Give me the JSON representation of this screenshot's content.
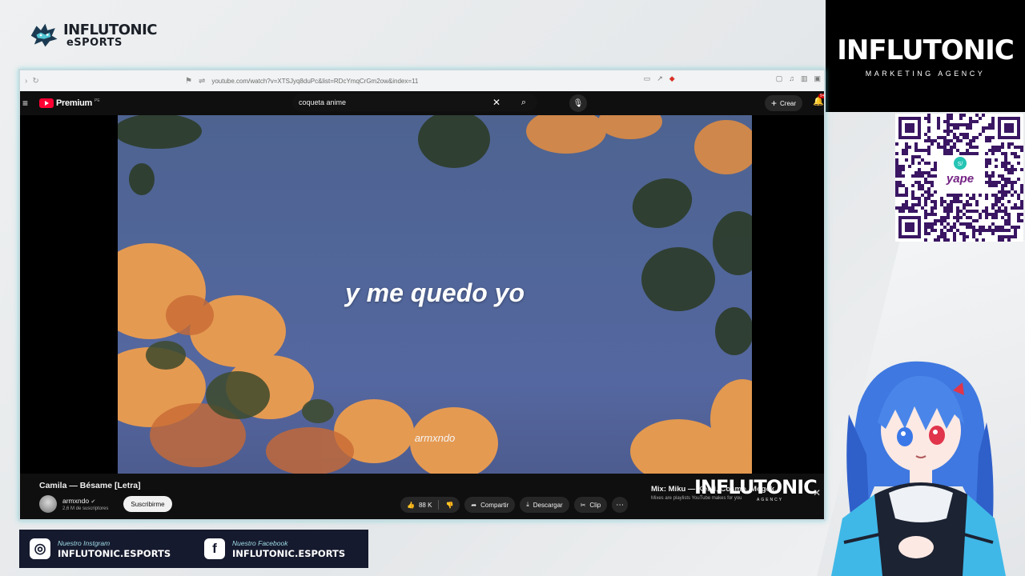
{
  "overlay": {
    "top_logo_line1": "INFLUTONIC",
    "top_logo_line2": "eSPORTS",
    "agency_name": "INFLUTONIC",
    "agency_tagline": "MARKETING AGENCY",
    "qr_label": "yape",
    "social": [
      {
        "icon": "instagram-icon",
        "label": "Nuestro Instgram",
        "handle": "INFLUTONIC.ESPORTS"
      },
      {
        "icon": "facebook-icon",
        "label": "Nuestro Facebook",
        "handle": "INFLUTONIC.ESPORTS"
      }
    ],
    "video_brand": "INFLUTONIC",
    "video_brand_sub": "AGENCY"
  },
  "browser": {
    "url": "youtube.com/watch?v=XTSJyq8duPc&list=RDcYmqCrGm2ow&index=11"
  },
  "youtube": {
    "logo_text": "Premium",
    "country_code": "PE",
    "search_query": "coqueta anime",
    "create_label": "Crear",
    "notification_count": "9+",
    "video": {
      "lyric": "y me quedo yo",
      "watermark": "armxndo",
      "title": "Camila — Bésame [Letra]"
    },
    "channel": {
      "name": "armxndo",
      "subscribers": "2,6 M de suscriptores",
      "subscribe_label": "Suscribirme"
    },
    "actions": {
      "likes": "88 K",
      "share": "Compartir",
      "download": "Descargar",
      "clip": "Clip"
    },
    "mix": {
      "title": "Mix: Miku — Kenji, Cosmo, Mogek...",
      "subtitle": "Mixes are playlists YouTube makes for you"
    }
  },
  "colors": {
    "yt_red": "#ff0033",
    "yt_bg": "#0f0f0f",
    "sky": "#51669a",
    "social_bar": "#161a2e",
    "accent_cyan": "#5ac8d2"
  }
}
